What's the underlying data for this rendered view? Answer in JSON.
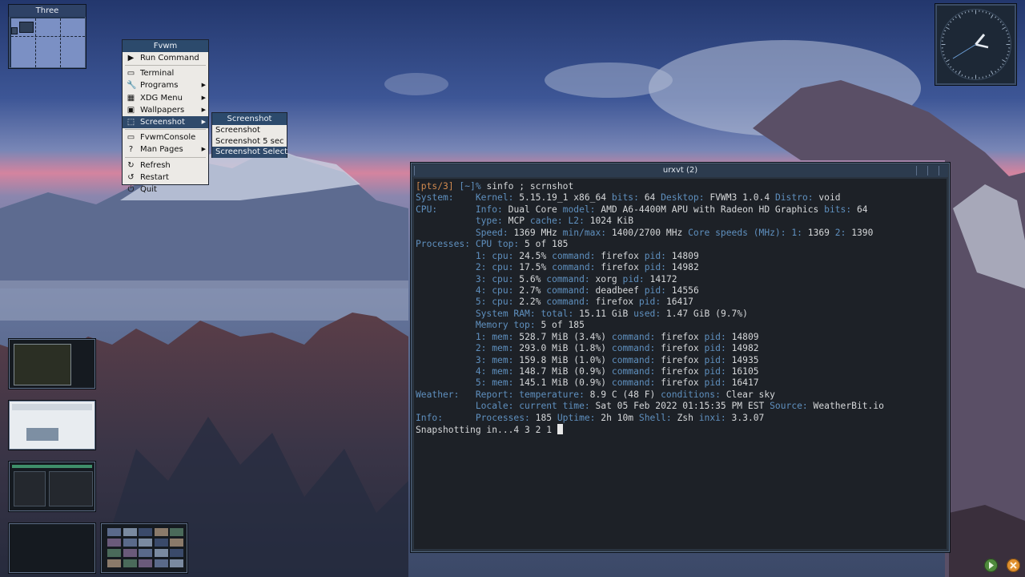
{
  "pager": {
    "title": "Three"
  },
  "fvwm_menu": {
    "title": "Fvwm",
    "items": [
      {
        "label": "Run Command",
        "icon": "play-icon",
        "has_submenu": false
      },
      {
        "label": "Terminal",
        "icon": "terminal-icon",
        "has_submenu": false
      },
      {
        "label": "Programs",
        "icon": "wrench-icon",
        "has_submenu": true
      },
      {
        "label": "XDG Menu",
        "icon": "grid-icon",
        "has_submenu": true
      },
      {
        "label": "Wallpapers",
        "icon": "image-icon",
        "has_submenu": true
      },
      {
        "label": "Screenshot",
        "icon": "screenshot-icon",
        "has_submenu": true,
        "active": true
      },
      {
        "label": "FvwmConsole",
        "icon": "console-icon",
        "has_submenu": false
      },
      {
        "label": "Man Pages",
        "icon": "help-icon",
        "has_submenu": true
      },
      {
        "label": "Refresh",
        "icon": "refresh-icon",
        "has_submenu": false
      },
      {
        "label": "Restart",
        "icon": "restart-icon",
        "has_submenu": false
      },
      {
        "label": "Quit",
        "icon": "power-icon",
        "has_submenu": false
      }
    ]
  },
  "screenshot_menu": {
    "title": "Screenshot",
    "items": [
      {
        "label": "Screenshot"
      },
      {
        "label": "Screenshot 5 sec"
      },
      {
        "label": "Screenshot Select",
        "active": true
      }
    ]
  },
  "terminal": {
    "title": "urxvt (2)",
    "prompt": "[pts/3]",
    "cwd": "[~]%",
    "command": " sinfo ; scrnshot",
    "lines": [
      {
        "l": "System:    ",
        "parts": [
          [
            "Kernel:",
            "k"
          ],
          [
            " 5.15.19_1 x86_64 ",
            "v"
          ],
          [
            "bits:",
            "k"
          ],
          [
            " 64 ",
            "v"
          ],
          [
            "Desktop:",
            "k"
          ],
          [
            " FVWM3 1.0.4 ",
            "v"
          ],
          [
            "Distro:",
            "k"
          ],
          [
            " void",
            "v"
          ]
        ]
      },
      {
        "l": "CPU:       ",
        "parts": [
          [
            "Info:",
            "k"
          ],
          [
            " Dual Core ",
            "v"
          ],
          [
            "model:",
            "k"
          ],
          [
            " AMD A6-4400M APU with Radeon HD Graphics ",
            "v"
          ],
          [
            "bits:",
            "k"
          ],
          [
            " 64",
            "v"
          ]
        ]
      },
      {
        "l": "           ",
        "parts": [
          [
            "type:",
            "k"
          ],
          [
            " MCP ",
            "v"
          ],
          [
            "cache:",
            "k"
          ],
          [
            " ",
            "v"
          ],
          [
            "L2:",
            "k"
          ],
          [
            " 1024 KiB",
            "v"
          ]
        ]
      },
      {
        "l": "           ",
        "parts": [
          [
            "Speed:",
            "k"
          ],
          [
            " 1369 MHz ",
            "v"
          ],
          [
            "min/max:",
            "k"
          ],
          [
            " 1400/2700 MHz ",
            "v"
          ],
          [
            "Core speeds (MHz):",
            "k"
          ],
          [
            " ",
            "v"
          ],
          [
            "1:",
            "k"
          ],
          [
            " 1369 ",
            "v"
          ],
          [
            "2:",
            "k"
          ],
          [
            " 1390",
            "v"
          ]
        ]
      },
      {
        "l": "Processes: ",
        "parts": [
          [
            "CPU top:",
            "k"
          ],
          [
            " 5 of 185",
            "v"
          ]
        ]
      },
      {
        "l": "           ",
        "parts": [
          [
            "1:",
            "k"
          ],
          [
            " ",
            "v"
          ],
          [
            "cpu:",
            "k"
          ],
          [
            " 24.5% ",
            "v"
          ],
          [
            "command:",
            "k"
          ],
          [
            " firefox ",
            "v"
          ],
          [
            "pid:",
            "k"
          ],
          [
            " 14809",
            "v"
          ]
        ]
      },
      {
        "l": "           ",
        "parts": [
          [
            "2:",
            "k"
          ],
          [
            " ",
            "v"
          ],
          [
            "cpu:",
            "k"
          ],
          [
            " 17.5% ",
            "v"
          ],
          [
            "command:",
            "k"
          ],
          [
            " firefox ",
            "v"
          ],
          [
            "pid:",
            "k"
          ],
          [
            " 14982",
            "v"
          ]
        ]
      },
      {
        "l": "           ",
        "parts": [
          [
            "3:",
            "k"
          ],
          [
            " ",
            "v"
          ],
          [
            "cpu:",
            "k"
          ],
          [
            " 5.6% ",
            "v"
          ],
          [
            "command:",
            "k"
          ],
          [
            " xorg ",
            "v"
          ],
          [
            "pid:",
            "k"
          ],
          [
            " 14172",
            "v"
          ]
        ]
      },
      {
        "l": "           ",
        "parts": [
          [
            "4:",
            "k"
          ],
          [
            " ",
            "v"
          ],
          [
            "cpu:",
            "k"
          ],
          [
            " 2.7% ",
            "v"
          ],
          [
            "command:",
            "k"
          ],
          [
            " deadbeef ",
            "v"
          ],
          [
            "pid:",
            "k"
          ],
          [
            " 14556",
            "v"
          ]
        ]
      },
      {
        "l": "           ",
        "parts": [
          [
            "5:",
            "k"
          ],
          [
            " ",
            "v"
          ],
          [
            "cpu:",
            "k"
          ],
          [
            " 2.2% ",
            "v"
          ],
          [
            "command:",
            "k"
          ],
          [
            " firefox ",
            "v"
          ],
          [
            "pid:",
            "k"
          ],
          [
            " 16417",
            "v"
          ]
        ]
      },
      {
        "l": "           ",
        "parts": [
          [
            "System RAM:",
            "k"
          ],
          [
            " ",
            "v"
          ],
          [
            "total:",
            "k"
          ],
          [
            " 15.11 GiB ",
            "v"
          ],
          [
            "used:",
            "k"
          ],
          [
            " 1.47 GiB (9.7%)",
            "v"
          ]
        ]
      },
      {
        "l": "           ",
        "parts": [
          [
            "Memory top:",
            "k"
          ],
          [
            " 5 of 185",
            "v"
          ]
        ]
      },
      {
        "l": "           ",
        "parts": [
          [
            "1:",
            "k"
          ],
          [
            " ",
            "v"
          ],
          [
            "mem:",
            "k"
          ],
          [
            " 528.7 MiB (3.4%) ",
            "v"
          ],
          [
            "command:",
            "k"
          ],
          [
            " firefox ",
            "v"
          ],
          [
            "pid:",
            "k"
          ],
          [
            " 14809",
            "v"
          ]
        ]
      },
      {
        "l": "           ",
        "parts": [
          [
            "2:",
            "k"
          ],
          [
            " ",
            "v"
          ],
          [
            "mem:",
            "k"
          ],
          [
            " 293.0 MiB (1.8%) ",
            "v"
          ],
          [
            "command:",
            "k"
          ],
          [
            " firefox ",
            "v"
          ],
          [
            "pid:",
            "k"
          ],
          [
            " 14982",
            "v"
          ]
        ]
      },
      {
        "l": "           ",
        "parts": [
          [
            "3:",
            "k"
          ],
          [
            " ",
            "v"
          ],
          [
            "mem:",
            "k"
          ],
          [
            " 159.8 MiB (1.0%) ",
            "v"
          ],
          [
            "command:",
            "k"
          ],
          [
            " firefox ",
            "v"
          ],
          [
            "pid:",
            "k"
          ],
          [
            " 14935",
            "v"
          ]
        ]
      },
      {
        "l": "           ",
        "parts": [
          [
            "4:",
            "k"
          ],
          [
            " ",
            "v"
          ],
          [
            "mem:",
            "k"
          ],
          [
            " 148.7 MiB (0.9%) ",
            "v"
          ],
          [
            "command:",
            "k"
          ],
          [
            " firefox ",
            "v"
          ],
          [
            "pid:",
            "k"
          ],
          [
            " 16105",
            "v"
          ]
        ]
      },
      {
        "l": "           ",
        "parts": [
          [
            "5:",
            "k"
          ],
          [
            " ",
            "v"
          ],
          [
            "mem:",
            "k"
          ],
          [
            " 145.1 MiB (0.9%) ",
            "v"
          ],
          [
            "command:",
            "k"
          ],
          [
            " firefox ",
            "v"
          ],
          [
            "pid:",
            "k"
          ],
          [
            " 16417",
            "v"
          ]
        ]
      },
      {
        "l": "Weather:   ",
        "parts": [
          [
            "Report:",
            "k"
          ],
          [
            " ",
            "v"
          ],
          [
            "temperature:",
            "k"
          ],
          [
            " 8.9 C (48 F) ",
            "v"
          ],
          [
            "conditions:",
            "k"
          ],
          [
            " Clear sky",
            "v"
          ]
        ]
      },
      {
        "l": "           ",
        "parts": [
          [
            "Locale:",
            "k"
          ],
          [
            " ",
            "v"
          ],
          [
            "current time:",
            "k"
          ],
          [
            " Sat 05 Feb 2022 01:15:35 PM EST ",
            "v"
          ],
          [
            "Source:",
            "k"
          ],
          [
            " WeatherBit.io",
            "v"
          ]
        ]
      },
      {
        "l": "Info:      ",
        "parts": [
          [
            "Processes:",
            "k"
          ],
          [
            " 185 ",
            "v"
          ],
          [
            "Uptime:",
            "k"
          ],
          [
            " 2h 10m ",
            "v"
          ],
          [
            "Shell:",
            "k"
          ],
          [
            " Zsh ",
            "v"
          ],
          [
            "inxi:",
            "k"
          ],
          [
            " 3.3.07",
            "v"
          ]
        ]
      }
    ],
    "last_line": "Snapshotting in...4 3 2 1 "
  },
  "taskbar_buttons": [
    {
      "icon": "next-arrow-icon",
      "color": "#6aa84f"
    },
    {
      "icon": "close-x-icon",
      "color": "#e69138"
    }
  ]
}
